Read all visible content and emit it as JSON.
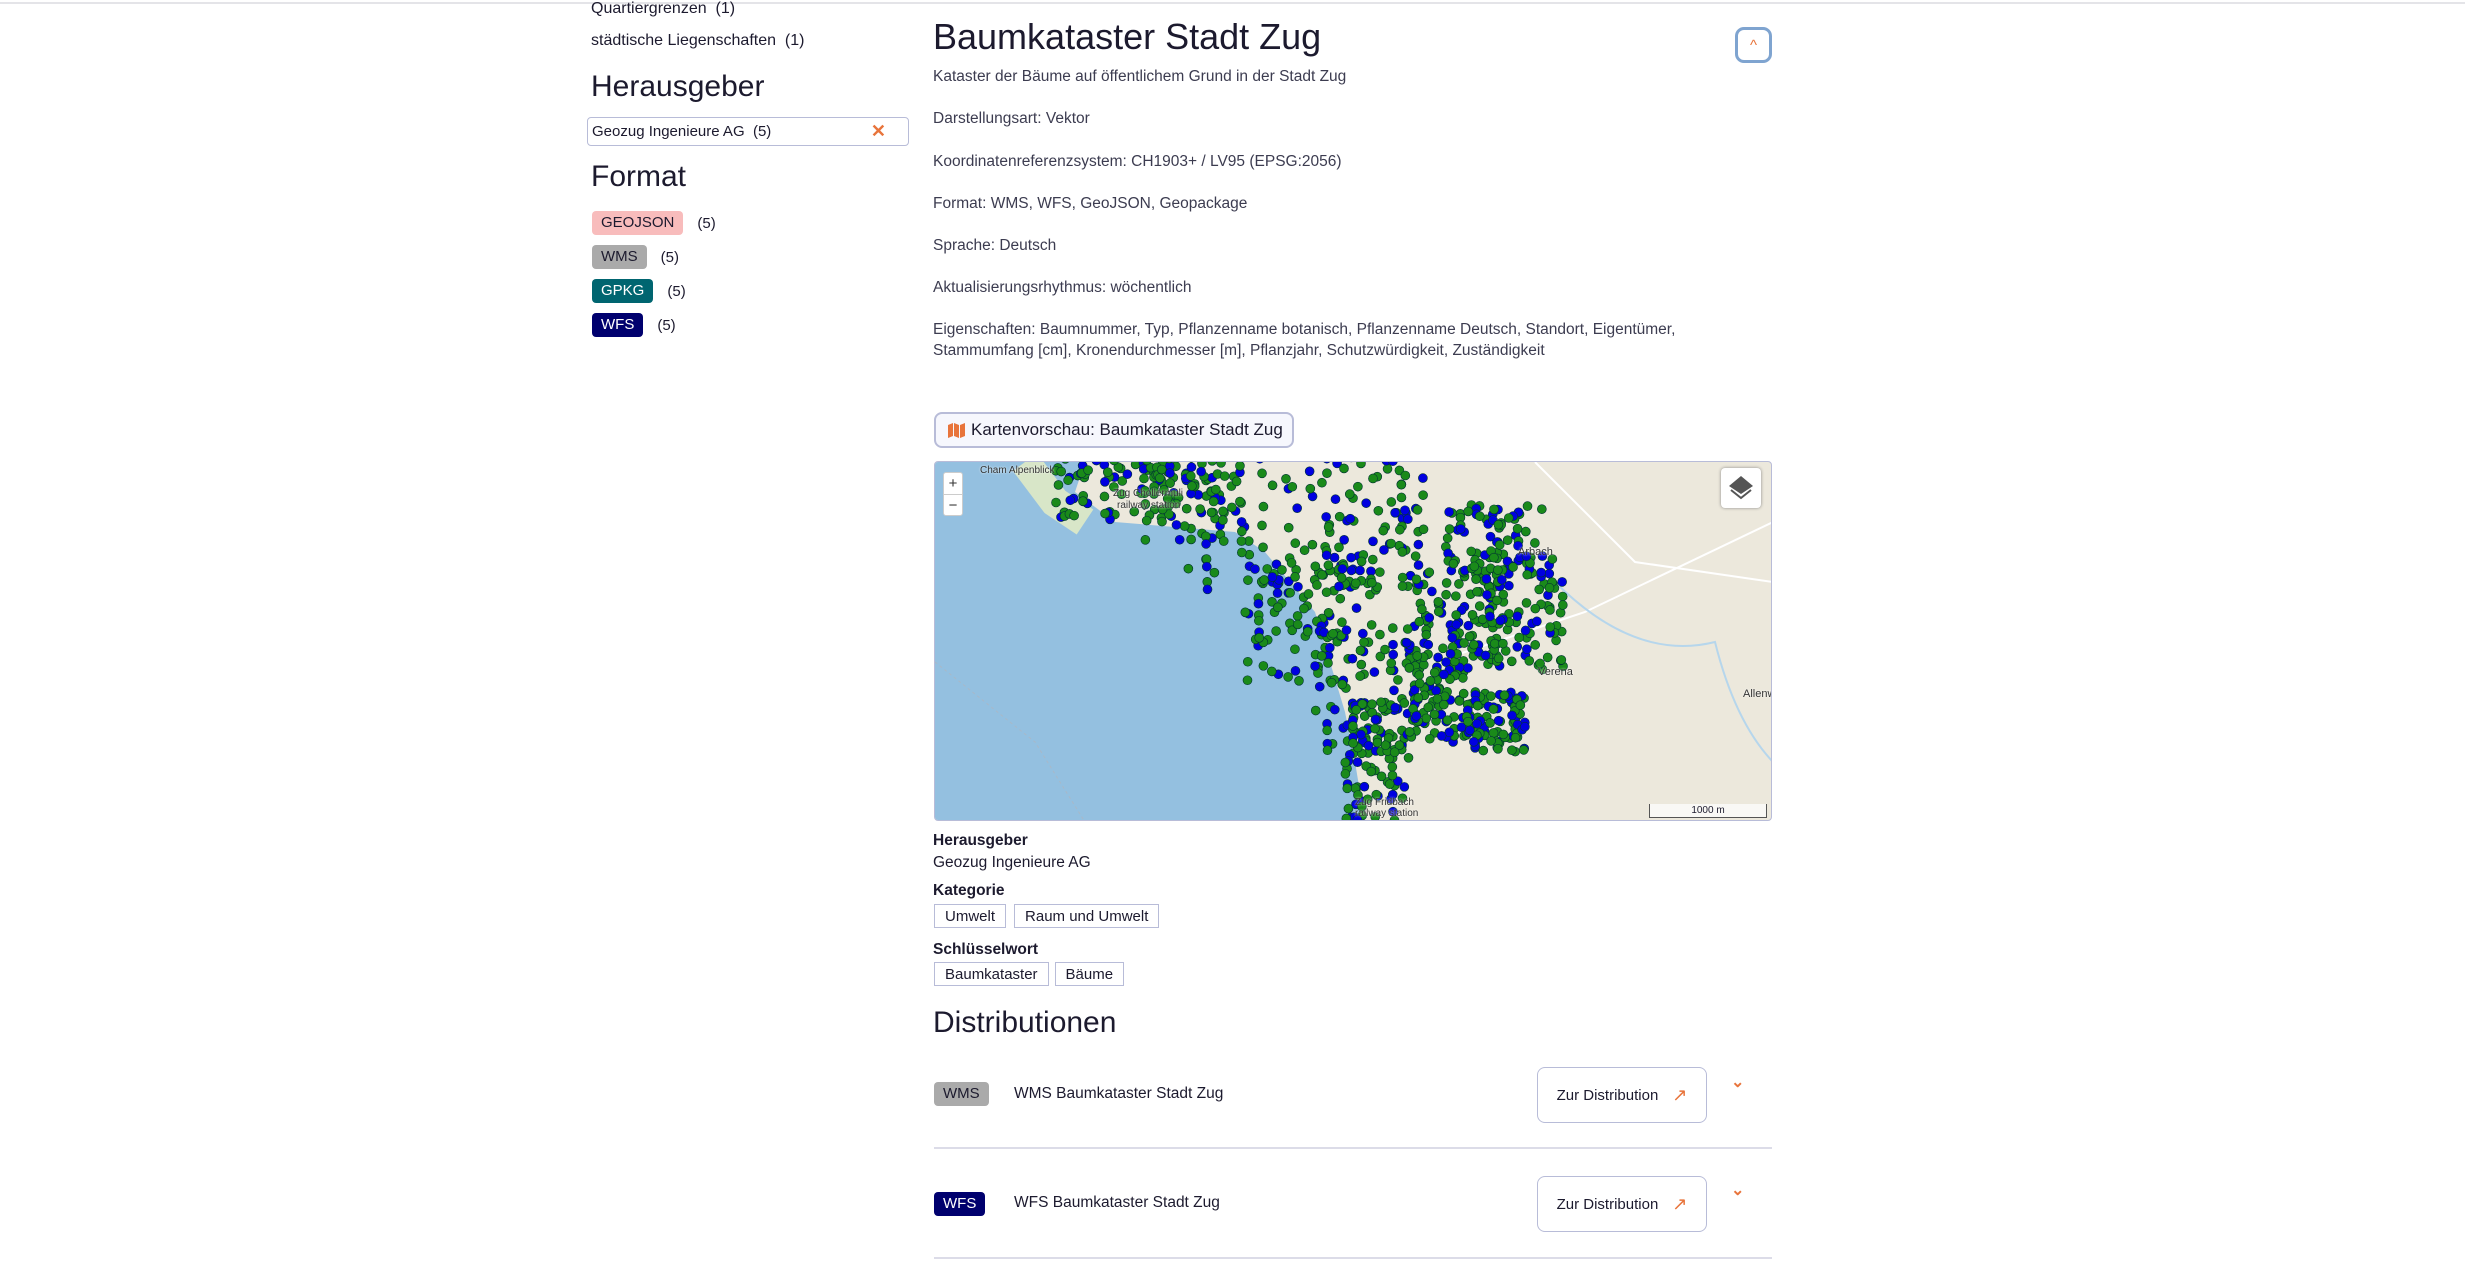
{
  "sidebar": {
    "categories": [
      {
        "label": "Quartiergrenzen",
        "count": "(1)"
      },
      {
        "label": "städtische Liegenschaften",
        "count": "(1)"
      }
    ],
    "publisher_heading": "Herausgeber",
    "publisher_filter": {
      "label": "Geozug Ingenieure AG",
      "count": "(5)",
      "remove_icon": "close-icon"
    },
    "format_heading": "Format",
    "formats": [
      {
        "label": "GEOJSON",
        "count": "(5)",
        "color": "#f8bcbc"
      },
      {
        "label": "WMS",
        "count": "(5)",
        "color": "#aaaaaa"
      },
      {
        "label": "GPKG",
        "count": "(5)",
        "color": "#006570"
      },
      {
        "label": "WFS",
        "count": "(5)",
        "color": "#00006e"
      }
    ]
  },
  "dataset": {
    "title": "Baumkataster Stadt Zug",
    "description": "Kataster der Bäume auf öffentlichem Grund in der Stadt Zug",
    "properties": [
      "Darstellungsart: Vektor",
      "Koordinatenreferenzsystem: CH1903+ / LV95 (EPSG:2056)",
      "Format: WMS, WFS, GeoJSON, Geopackage",
      "Sprache: Deutsch",
      "Aktualisierungsrhythmus: wöchentlich",
      "Eigenschaften: Baumnummer, Typ, Pflanzenname botanisch, Pflanzenname Deutsch, Standort, Eigentümer, Stammumfang [cm], Kronendurchmesser [m], Pflanzjahr, Schutzwürdigkeit, Zuständigkeit"
    ],
    "collapse_icon": "chevron-up-icon",
    "map_preview_button": "Kartenvorschau: Baumkataster Stadt Zug",
    "map": {
      "zoom_in": "+",
      "zoom_out": "−",
      "labels": {
        "cham": "Cham Alpenblick",
        "chollermuli": "Zug Chollermüli",
        "chollermuli2": "railway station",
        "arbach": "Arbach",
        "verena": "Verena",
        "allenwi": "Allenwi",
        "fridbach": "Zug Fridbach",
        "fridbach2": "railway station"
      },
      "scale": "1000 m",
      "colors": {
        "water": "#94c0e0",
        "land": "#ece8dc",
        "green_points": "#1a8a1a",
        "blue_points": "#0000e0"
      }
    },
    "publisher_label": "Herausgeber",
    "publisher_value": "Geozug Ingenieure AG",
    "category_label": "Kategorie",
    "categories": [
      "Umwelt",
      "Raum und Umwelt"
    ],
    "keyword_label": "Schlüsselwort",
    "keywords": [
      "Baumkataster",
      "Bäume"
    ]
  },
  "distributions": {
    "heading": "Distributionen",
    "items": [
      {
        "format": "WMS",
        "title": "WMS Baumkataster Stadt Zug",
        "button": "Zur Distribution"
      },
      {
        "format": "WFS",
        "title": "WFS Baumkataster Stadt Zug",
        "button": "Zur Distribution"
      }
    ]
  },
  "accent_color": "#e8743b"
}
